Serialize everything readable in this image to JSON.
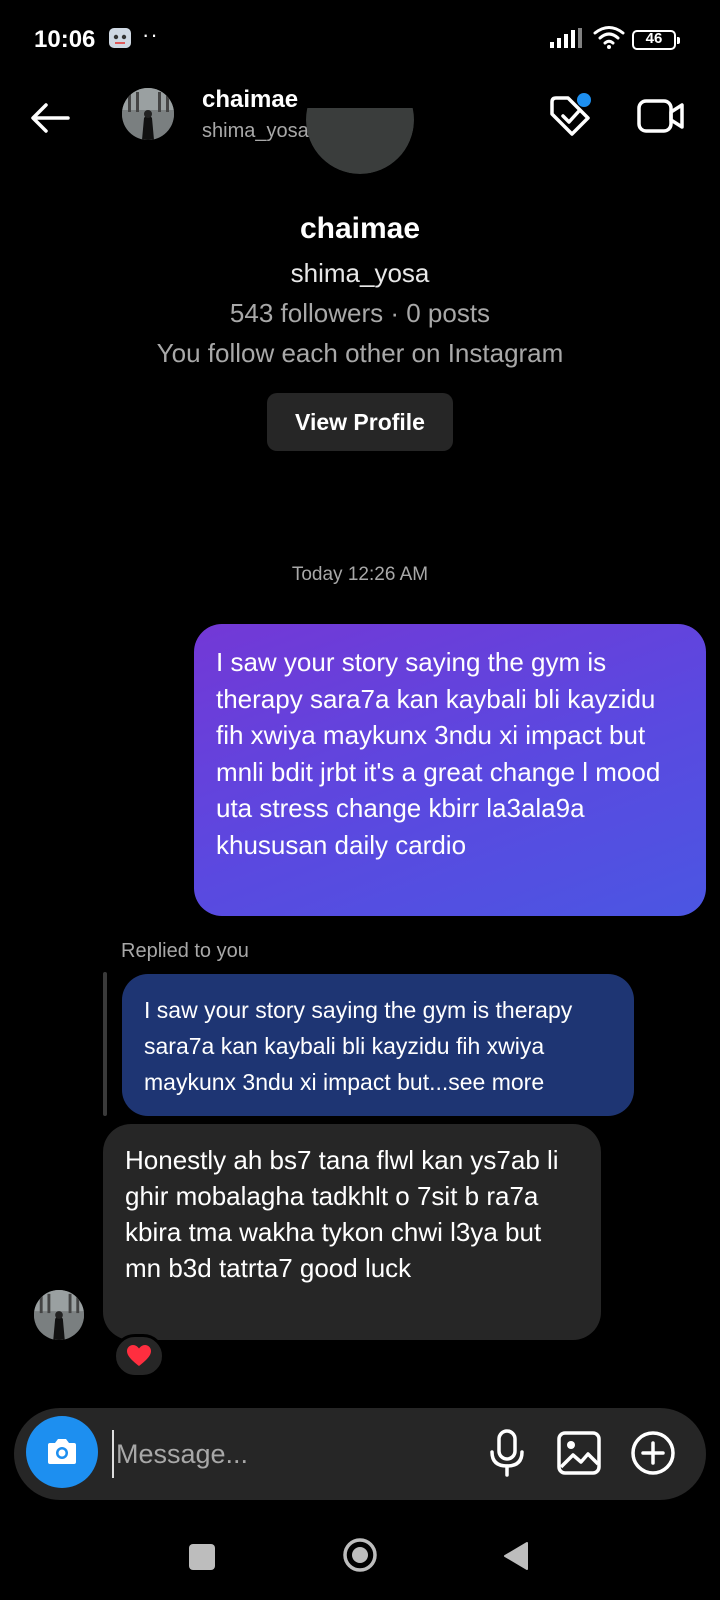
{
  "status_bar": {
    "time": "10:06",
    "dots": "··",
    "battery": "46"
  },
  "header": {
    "name": "chaimae",
    "username": "shima_yosa"
  },
  "profile": {
    "name": "chaimae",
    "username": "shima_yosa",
    "stats": "543 followers · 0 posts",
    "mutual": "You follow each other on Instagram",
    "view_profile_label": "View Profile"
  },
  "conversation": {
    "timestamp": "Today 12:26 AM",
    "sent_message": "I saw your story saying the gym is therapy sara7a kan kaybali bli kayzidu fih xwiya  maykunx 3ndu xi impact but mnli bdit jrbt it's a great change l mood uta stress  change kbirr la3ala9a khususan daily cardio",
    "replied_label": "Replied to you",
    "reply_quote": "I saw your story saying the gym is therapy sara7a kan kaybali bli kayzidu fih xwiya maykunx 3ndu xi  impact but...see more",
    "received_message": "Honestly ah bs7 tana flwl kan ys7ab li ghir mobalagha tadkhlt o 7sit b ra7a  kbira tma wakha tykon chwi l3ya but mn b3d tatrta7 good luck",
    "reaction": "❤️"
  },
  "composer": {
    "placeholder": "Message..."
  },
  "colors": {
    "background": "#000000",
    "sent_gradient_start": "#7338d6",
    "sent_gradient_end": "#4b56e2",
    "reply_quote_bg": "#1e3573",
    "received_bg": "#262626",
    "camera_button": "#1d8ff0",
    "badge_dot": "#1d8ff0",
    "secondary_text": "#a8a8a8"
  },
  "icons": {
    "back": "arrow-left-icon",
    "tag": "tag-icon",
    "video": "video-camera-icon",
    "camera": "camera-icon",
    "mic": "microphone-icon",
    "gallery": "image-icon",
    "plus": "plus-circle-icon"
  }
}
